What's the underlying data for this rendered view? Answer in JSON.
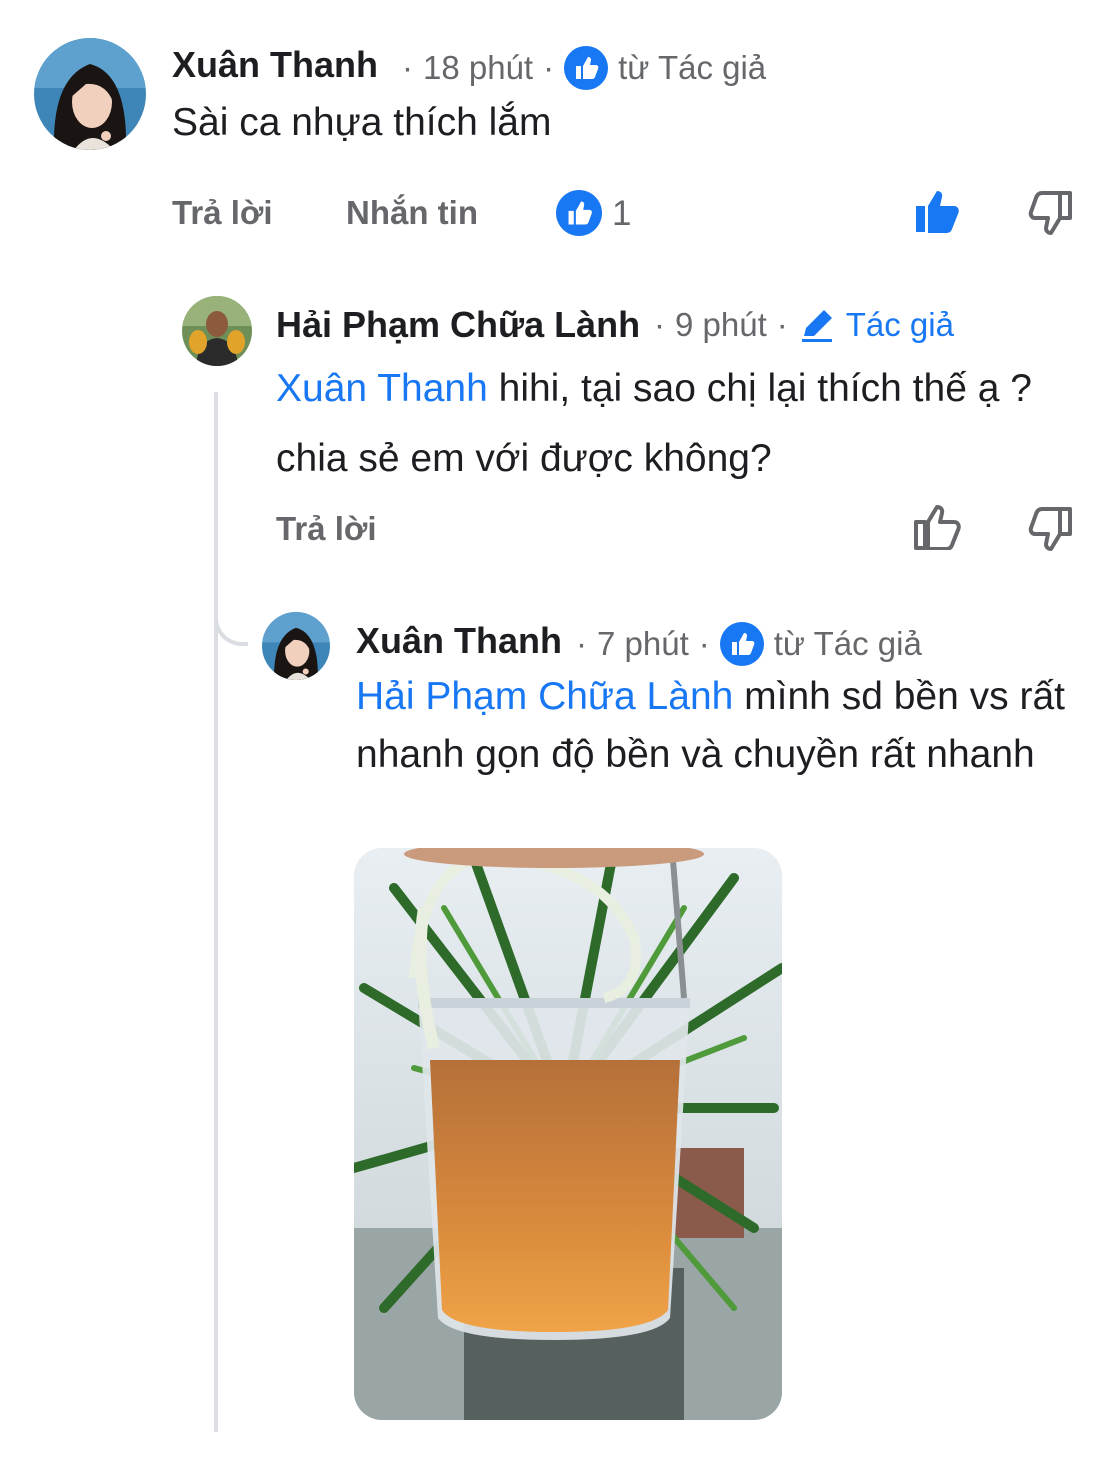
{
  "comments": [
    {
      "author": "Xuân Thanh",
      "time": "18 phút",
      "badge": "từ Tác giả",
      "badge_icon": "like-circle-icon",
      "text": "Sài ca nhựa thích lắm",
      "actions": {
        "reply": "Trả lời",
        "message": "Nhắn tin",
        "like_count": "1"
      },
      "liked": true
    },
    {
      "author": "Hải Phạm Chữa Lành",
      "time": "9 phút",
      "badge": "Tác giả",
      "badge_icon": "pencil-icon",
      "mention": "Xuân Thanh",
      "text": " hihi, tại sao chị lại thích thế ạ ? chia sẻ em với được không?",
      "actions": {
        "reply": "Trả lời"
      }
    },
    {
      "author": "Xuân Thanh",
      "time": "7 phút",
      "badge": "từ Tác giả",
      "badge_icon": "like-circle-icon",
      "mention": "Hải Phạm Chữa Lành",
      "text": " mình sd bền vs rất nhanh gọn độ bền và chuyền rất nhanh",
      "has_photo": true
    }
  ],
  "colors": {
    "accent": "#1877f2",
    "secondary_text": "#65676b",
    "thread_line": "#dadde1"
  }
}
